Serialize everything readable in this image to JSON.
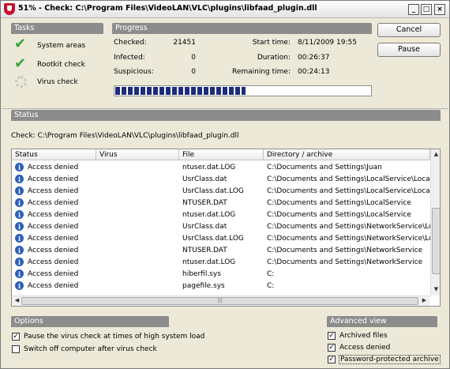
{
  "window": {
    "title": "51% - Check: C:\\Program Files\\VideoLAN\\VLC\\plugins\\libfaad_plugin.dll",
    "min_label": "_",
    "max_label": "□",
    "close_label": "×"
  },
  "tasks": {
    "header": "Tasks",
    "items": [
      {
        "label": "System areas",
        "state": "done"
      },
      {
        "label": "Rootkit check",
        "state": "done"
      },
      {
        "label": "Virus check",
        "state": "running"
      }
    ]
  },
  "progress": {
    "header": "Progress",
    "checked_label": "Checked:",
    "checked_value": "21451",
    "infected_label": "Infected:",
    "infected_value": "0",
    "suspicious_label": "Suspicious:",
    "suspicious_value": "0",
    "start_label": "Start time:",
    "start_value": "8/11/2009 19:55",
    "duration_label": "Duration:",
    "duration_value": "00:26:37",
    "remaining_label": "Remaining time:",
    "remaining_value": "00:24:13",
    "percent": 51
  },
  "buttons": {
    "cancel": "Cancel",
    "pause": "Pause"
  },
  "status": {
    "header": "Status",
    "check_line": "Check: C:\\Program Files\\VideoLAN\\VLC\\plugins\\libfaad_plugin.dll",
    "columns": [
      "Status",
      "Virus",
      "File",
      "Directory / archive"
    ],
    "rows": [
      {
        "status": "Access denied",
        "virus": "",
        "file": "ntuser.dat.LOG",
        "dir": "C:\\Documents and Settings\\Juan"
      },
      {
        "status": "Access denied",
        "virus": "",
        "file": "UsrClass.dat",
        "dir": "C:\\Documents and Settings\\LocalService\\Local ..."
      },
      {
        "status": "Access denied",
        "virus": "",
        "file": "UsrClass.dat.LOG",
        "dir": "C:\\Documents and Settings\\LocalService\\Local ..."
      },
      {
        "status": "Access denied",
        "virus": "",
        "file": "NTUSER.DAT",
        "dir": "C:\\Documents and Settings\\LocalService"
      },
      {
        "status": "Access denied",
        "virus": "",
        "file": "ntuser.dat.LOG",
        "dir": "C:\\Documents and Settings\\LocalService"
      },
      {
        "status": "Access denied",
        "virus": "",
        "file": "UsrClass.dat",
        "dir": "C:\\Documents and Settings\\NetworkService\\Loc..."
      },
      {
        "status": "Access denied",
        "virus": "",
        "file": "UsrClass.dat.LOG",
        "dir": "C:\\Documents and Settings\\NetworkService\\Loc..."
      },
      {
        "status": "Access denied",
        "virus": "",
        "file": "NTUSER.DAT",
        "dir": "C:\\Documents and Settings\\NetworkService"
      },
      {
        "status": "Access denied",
        "virus": "",
        "file": "ntuser.dat.LOG",
        "dir": "C:\\Documents and Settings\\NetworkService"
      },
      {
        "status": "Access denied",
        "virus": "",
        "file": "hiberfil.sys",
        "dir": "C:"
      },
      {
        "status": "Access denied",
        "virus": "",
        "file": "pagefile.sys",
        "dir": "C:"
      }
    ]
  },
  "options": {
    "header": "Options",
    "items": [
      {
        "label": "Pause the virus check at times of high system load",
        "checked": true
      },
      {
        "label": "Switch off computer after virus check",
        "checked": false
      }
    ]
  },
  "advanced": {
    "header": "Advanced view",
    "items": [
      {
        "label": "Archived files",
        "checked": true
      },
      {
        "label": "Access denied",
        "checked": true
      },
      {
        "label": "Password-protected archive",
        "checked": true
      }
    ]
  }
}
